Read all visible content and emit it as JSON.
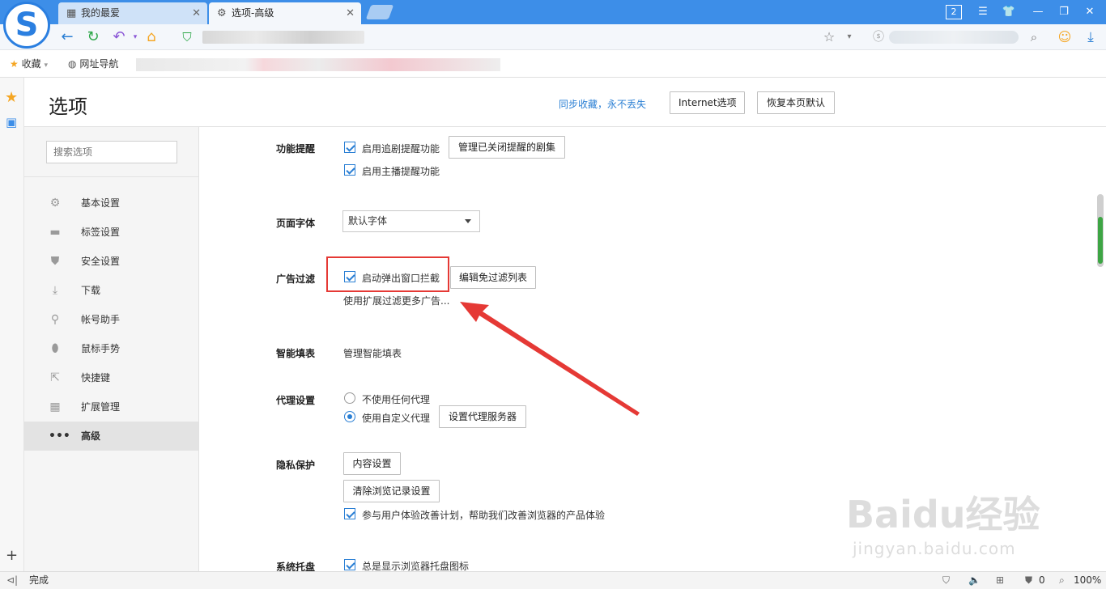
{
  "tabs": [
    {
      "label": "我的最爱",
      "icon": "grid-icon"
    },
    {
      "label": "选项-高级",
      "icon": "gear-icon"
    }
  ],
  "titlebar": {
    "badge": "2"
  },
  "bookmarks": [
    {
      "label": "收藏",
      "icon": "star-icon"
    },
    {
      "label": "网址导航",
      "icon": "globe-icon"
    }
  ],
  "page": {
    "title": "选项",
    "sync_link": "同步收藏，永不丢失",
    "internet_button": "Internet选项",
    "restore_button": "恢复本页默认"
  },
  "sidebar": {
    "search_placeholder": "搜索选项",
    "items": [
      {
        "label": "基本设置",
        "icon": "gear-icon"
      },
      {
        "label": "标签设置",
        "icon": "tab-icon"
      },
      {
        "label": "安全设置",
        "icon": "shield-check-icon"
      },
      {
        "label": "下载",
        "icon": "download-icon"
      },
      {
        "label": "帐号助手",
        "icon": "key-icon"
      },
      {
        "label": "鼠标手势",
        "icon": "mouse-icon"
      },
      {
        "label": "快捷键",
        "icon": "shortcut-icon"
      },
      {
        "label": "扩展管理",
        "icon": "extensions-icon"
      },
      {
        "label": "高级",
        "icon": "more-icon",
        "active": true
      }
    ]
  },
  "sections": {
    "reminder": {
      "label": "功能提醒",
      "opt1": "启用追剧提醒功能",
      "opt1_button": "管理已关闭提醒的剧集",
      "opt2": "启用主播提醒功能"
    },
    "font": {
      "label": "页面字体",
      "value": "默认字体"
    },
    "adblock": {
      "label": "广告过滤",
      "opt1": "启动弹出窗口拦截",
      "button": "编辑免过滤列表",
      "link": "使用扩展过滤更多广告..."
    },
    "autofill": {
      "label": "智能填表",
      "link": "管理智能填表"
    },
    "proxy": {
      "label": "代理设置",
      "opt1": "不使用任何代理",
      "opt2": "使用自定义代理",
      "button": "设置代理服务器"
    },
    "privacy": {
      "label": "隐私保护",
      "button1": "内容设置",
      "button2": "清除浏览记录设置",
      "opt1": "参与用户体验改善计划，帮助我们改善浏览器的产品体验"
    },
    "tray": {
      "label": "系统托盘",
      "opt1": "总是显示浏览器托盘图标"
    }
  },
  "status": {
    "text": "完成",
    "ad_count": "0",
    "zoom": "100%"
  },
  "watermark": {
    "main": "Baidu经验",
    "sub": "jingyan.baidu.com"
  },
  "colors": {
    "accent": "#2a7fd4",
    "titlebar": "#3d8ee8",
    "highlight": "#e53935"
  }
}
